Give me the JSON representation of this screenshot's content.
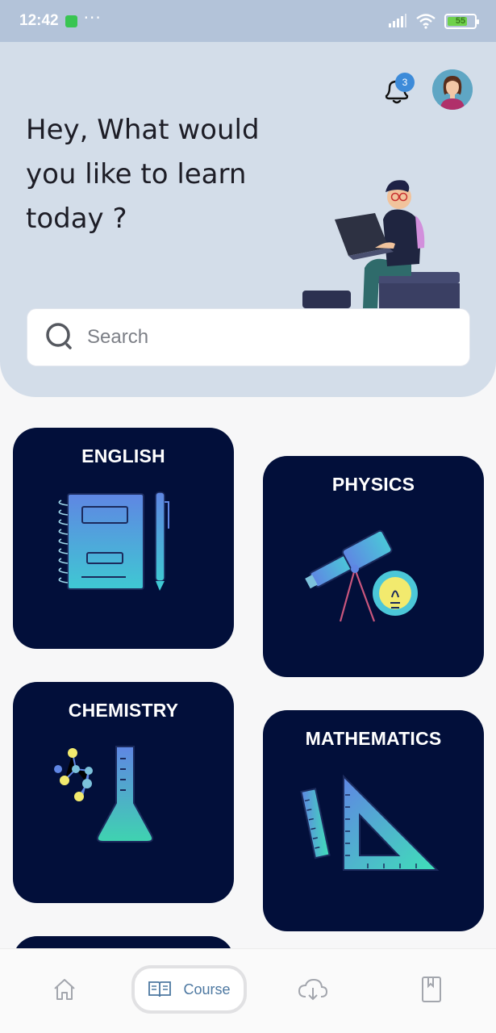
{
  "status_bar": {
    "time": "12:42",
    "dots": "···",
    "battery": "55"
  },
  "header": {
    "notification_count": "3",
    "greeting": "Hey, What would you like to learn today ?"
  },
  "search": {
    "placeholder": "Search"
  },
  "courses": [
    {
      "title": "ENGLISH"
    },
    {
      "title": "PHYSICS"
    },
    {
      "title": "CHEMISTRY"
    },
    {
      "title": "MATHEMATICS"
    }
  ],
  "bottom_nav": {
    "course_label": "Course"
  },
  "colors": {
    "card_bg": "#020f3a",
    "accent": "#4d78a1",
    "hero_bg": "#d3dde9"
  },
  "icons": [
    "search-icon",
    "bell-icon",
    "home-icon",
    "book-icon",
    "cloud-download-icon",
    "bookmark-icon"
  ]
}
